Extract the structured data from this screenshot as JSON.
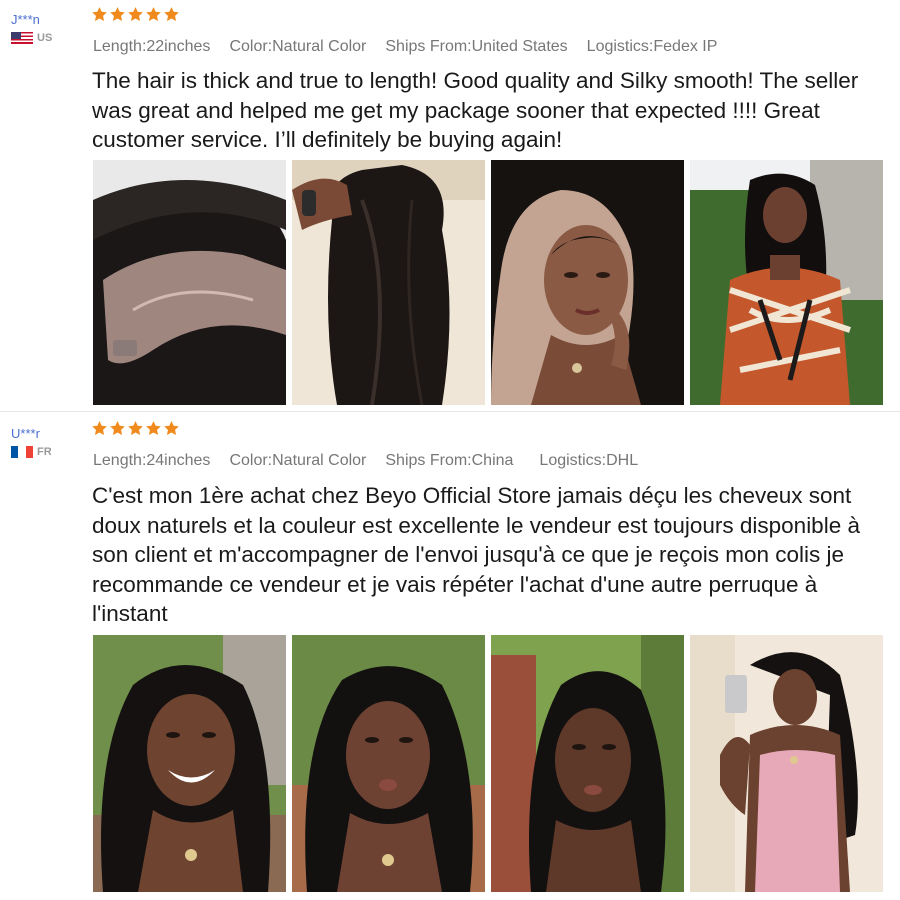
{
  "colors": {
    "star": "#f08a1c",
    "reviewer_name": "#4a6fd0",
    "attributes": "#777777"
  },
  "reviews": [
    {
      "reviewer": "J***n",
      "country_code": "US",
      "flag_icon": "us-flag-icon",
      "rating": 5,
      "attributes": {
        "length": "Length:22inches",
        "color": "Color:Natural Color",
        "ships_from": "Ships From:United States",
        "logistics": "Logistics:Fedex IP"
      },
      "text": "The hair is thick and true to length! Good quality and Silky smooth! The seller was great and helped me get my package sooner that expected !!!! Great customer service. I’ll definitely be buying again!",
      "photos": [
        {
          "icon": "wig-lace-closeup-photo"
        },
        {
          "icon": "wig-bundle-held-photo"
        },
        {
          "icon": "woman-portrait-photo"
        },
        {
          "icon": "woman-patterned-dress-photo"
        }
      ]
    },
    {
      "reviewer": "U***r",
      "country_code": "FR",
      "flag_icon": "fr-flag-icon",
      "rating": 5,
      "attributes": {
        "length": "Length:24inches",
        "color": "Color:Natural Color",
        "ships_from": "Ships From:China",
        "logistics": "Logistics:DHL"
      },
      "text": "C'est mon 1ère achat chez Beyo Official Store jamais déçu les cheveux sont doux naturels et la couleur est excellente le vendeur est toujours disponible à son client et m'accompagner de l'envoi jusqu'à ce que je reçois mon colis je recommande ce vendeur et je vais répéter l'achat d'une autre perruque à l'instant",
      "photos": [
        {
          "icon": "woman-smiling-photo"
        },
        {
          "icon": "woman-closeup-photo"
        },
        {
          "icon": "woman-outdoor-photo"
        },
        {
          "icon": "woman-mirror-selfie-photo"
        }
      ]
    }
  ]
}
